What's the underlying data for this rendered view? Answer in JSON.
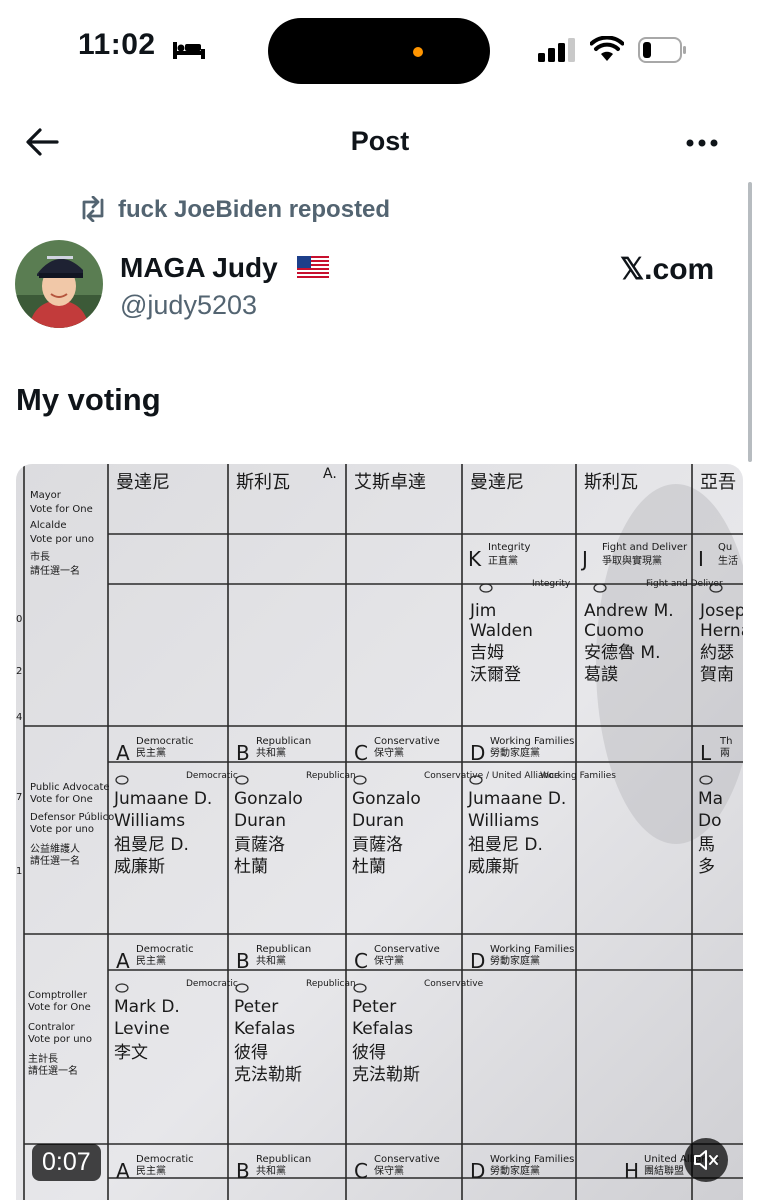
{
  "status_bar": {
    "time": "11:02"
  },
  "nav": {
    "title": "Post"
  },
  "repost": {
    "text": "fuck JoeBiden reposted"
  },
  "author": {
    "name": "MAGA Judy",
    "handle": "@judy5203"
  },
  "source": {
    "label": "𝕏.com"
  },
  "post": {
    "text": "My voting"
  },
  "video": {
    "timestamp": "0:07",
    "ballot": {
      "top_row_names": [
        {
          "zh": "曼達尼",
          "en": ""
        },
        {
          "zh": "斯利瓦",
          "en": "A."
        },
        {
          "zh": "艾斯卓達",
          "en": ""
        },
        {
          "zh": "曼達尼",
          "en": ""
        },
        {
          "zh": "斯利瓦",
          "en": ""
        },
        {
          "zh": "亞吾",
          "en": ""
        }
      ],
      "sections": [
        {
          "label_lines": [
            "Mayor",
            "Vote for One",
            "Alcalde",
            "Vote por uno",
            "市長",
            "請任選一名"
          ],
          "parties": [
            {
              "letter": "K",
              "party": "Integrity",
              "zh": "正直黨"
            },
            {
              "letter": "J",
              "party": "Fight and Deliver",
              "zh": "爭取與實現黨"
            },
            {
              "letter": "I",
              "party": "Qu",
              "zh": "生活"
            }
          ],
          "candidates": [
            {
              "party": "Integrity",
              "name1": "Jim",
              "name2": "Walden",
              "zh1": "吉姆",
              "zh2": "沃爾登"
            },
            {
              "party": "Fight and Deliver",
              "name1": "Andrew M.",
              "name2": "Cuomo",
              "zh1": "安德魯 M.",
              "zh2": "葛謨"
            },
            {
              "party": "",
              "name1": "Josep",
              "name2": "Herna",
              "zh1": "約瑟",
              "zh2": "賀南"
            }
          ]
        },
        {
          "label_lines": [
            "Public Advocate",
            "Vote for One",
            "Defensor Público",
            "Vote por uno",
            "公益維護人",
            "請任選一名"
          ],
          "parties": [
            {
              "letter": "A",
              "party": "Democratic",
              "zh": "民主黨"
            },
            {
              "letter": "B",
              "party": "Republican",
              "zh": "共和黨"
            },
            {
              "letter": "C",
              "party": "Conservative",
              "zh": "保守黨"
            },
            {
              "letter": "D",
              "party": "Working Families",
              "zh": "勞動家庭黨"
            },
            {
              "letter": "L",
              "party": "Th",
              "zh": "兩"
            }
          ],
          "candidates": [
            {
              "party": "Democratic",
              "name1": "Jumaane D.",
              "name2": "Williams",
              "zh1": "祖曼尼 D.",
              "zh2": "威廉斯"
            },
            {
              "party": "Republican",
              "name1": "Gonzalo",
              "name2": "Duran",
              "zh1": "貢薩洛",
              "zh2": "杜蘭"
            },
            {
              "party": "Conservative / United Alliance",
              "name1": "Gonzalo",
              "name2": "Duran",
              "zh1": "貢薩洛",
              "zh2": "杜蘭"
            },
            {
              "party": "Working Families",
              "name1": "Jumaane D.",
              "name2": "Williams",
              "zh1": "祖曼尼 D.",
              "zh2": "威廉斯"
            },
            {
              "party": "",
              "name1": "Ma",
              "name2": "Do",
              "zh1": "馬",
              "zh2": "多"
            }
          ]
        },
        {
          "label_lines": [
            "Comptroller",
            "Vote for One",
            "Contralor",
            "Vote por uno",
            "主計長",
            "請任選一名"
          ],
          "parties": [
            {
              "letter": "A",
              "party": "Democratic",
              "zh": "民主黨"
            },
            {
              "letter": "B",
              "party": "Republican",
              "zh": "共和黨"
            },
            {
              "letter": "C",
              "party": "Conservative",
              "zh": "保守黨"
            },
            {
              "letter": "D",
              "party": "Working Families",
              "zh": "勞動家庭黨"
            }
          ],
          "candidates": [
            {
              "party": "Democratic",
              "name1": "Mark D.",
              "name2": "Levine",
              "zh1": "李文",
              "zh2": ""
            },
            {
              "party": "Republican",
              "name1": "Peter",
              "name2": "Kefalas",
              "zh1": "彼得",
              "zh2": "克法勒斯"
            },
            {
              "party": "Conservative",
              "name1": "Peter",
              "name2": "Kefalas",
              "zh1": "彼得",
              "zh2": "克法勒斯"
            }
          ]
        },
        {
          "label_lines": [],
          "parties": [
            {
              "letter": "A",
              "party": "Democratic",
              "zh": "民主黨"
            },
            {
              "letter": "B",
              "party": "Republican",
              "zh": "共和黨"
            },
            {
              "letter": "C",
              "party": "Conservative",
              "zh": "保守黨"
            },
            {
              "letter": "D",
              "party": "Working Families",
              "zh": "勞動家庭黨"
            },
            {
              "letter": "H",
              "party": "United Alliance",
              "zh": "團結聯盟"
            }
          ],
          "candidates": []
        }
      ],
      "margin_numbers": [
        "0",
        "2",
        "4",
        "7",
        "1"
      ]
    }
  }
}
